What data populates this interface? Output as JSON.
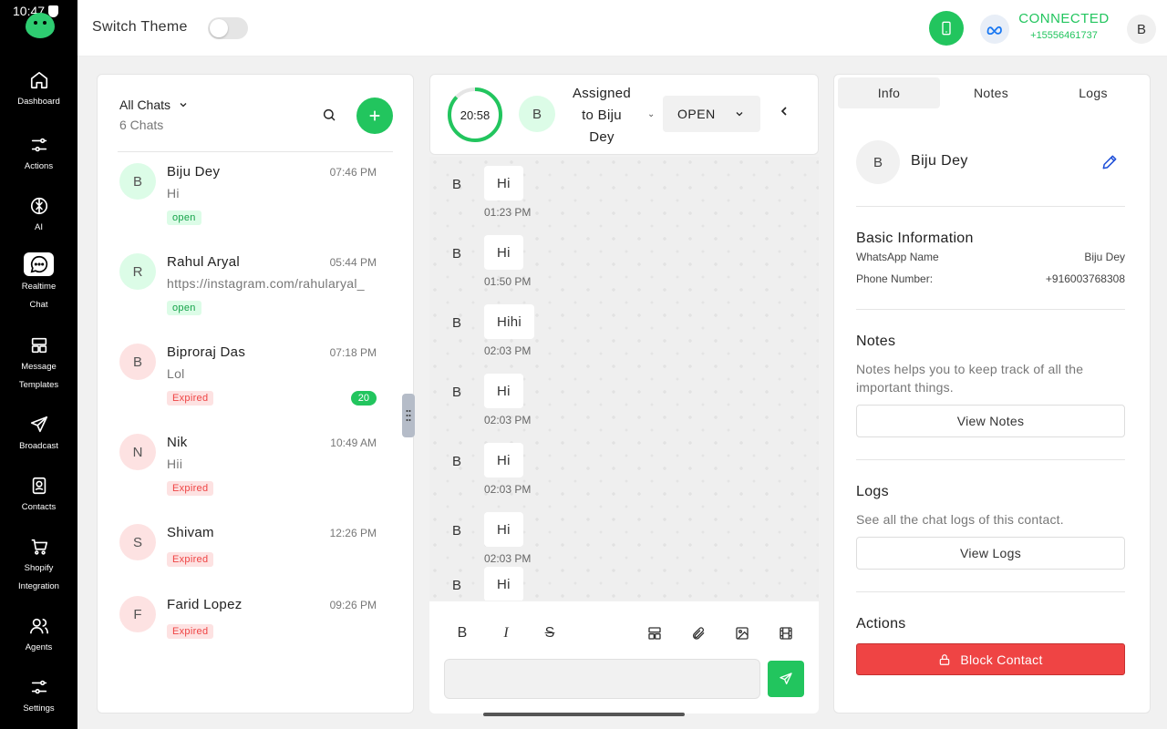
{
  "status_bar": {
    "time": "10:47"
  },
  "sidebar": {
    "items": [
      {
        "label": "Dashboard",
        "icon": "home-icon"
      },
      {
        "label": "Actions",
        "icon": "sliders-icon"
      },
      {
        "label": "AI",
        "icon": "brain-icon"
      },
      {
        "label_line1": "Realtime",
        "label_line2": "Chat",
        "icon": "chat-bubble-icon",
        "active": true
      },
      {
        "label_line1": "Message",
        "label_line2": "Templates",
        "icon": "template-icon"
      },
      {
        "label": "Broadcast",
        "icon": "send-icon"
      },
      {
        "label": "Contacts",
        "icon": "contact-card-icon"
      },
      {
        "label_line1": "Shopify",
        "label_line2": "Integration",
        "icon": "cart-icon"
      },
      {
        "label": "Agents",
        "icon": "users-icon"
      },
      {
        "label": "Settings",
        "icon": "settings-sliders-icon"
      }
    ]
  },
  "topbar": {
    "theme_label": "Switch Theme",
    "theme_dark": false,
    "connection_status": "CONNECTED",
    "phone_number": "+15556461737",
    "user_initial": "B",
    "accent_color": "#22c55e"
  },
  "chat_list": {
    "filter_label": "All Chats",
    "count_label": "6 Chats",
    "chats": [
      {
        "initial": "B",
        "name": "Biju Dey",
        "time": "07:46 PM",
        "preview": "Hi",
        "status": "open"
      },
      {
        "initial": "R",
        "name": "Rahul Aryal",
        "time": "05:44 PM",
        "preview": "https://instagram.com/rahularyal_",
        "status": "open"
      },
      {
        "initial": "B",
        "name": "Biproraj Das",
        "time": "07:18 PM",
        "preview": "Lol",
        "status": "Expired",
        "unread": "20"
      },
      {
        "initial": "N",
        "name": "Nik",
        "time": "10:49 AM",
        "preview": "Hii",
        "status": "Expired"
      },
      {
        "initial": "S",
        "name": "Shivam",
        "time": "12:26 PM",
        "preview": "",
        "status": "Expired"
      },
      {
        "initial": "F",
        "name": "Farid Lopez",
        "time": "09:26 PM",
        "preview": "",
        "status": "Expired"
      }
    ]
  },
  "chat_header": {
    "timer": "20:58",
    "timer_fraction_remaining": 0.87,
    "assignee_initial": "B",
    "assigned_line1": "Assigned",
    "assigned_line2": "to Biju",
    "assigned_line3": "Dey",
    "status_value": "OPEN"
  },
  "messages": [
    {
      "initial": "B",
      "text": "Hi",
      "time": "01:23 PM"
    },
    {
      "initial": "B",
      "text": "Hi",
      "time": "01:50 PM"
    },
    {
      "initial": "B",
      "text": "Hihi",
      "time": "02:03 PM"
    },
    {
      "initial": "B",
      "text": "Hi",
      "time": "02:03 PM"
    },
    {
      "initial": "B",
      "text": "Hi",
      "time": "02:03 PM"
    },
    {
      "initial": "B",
      "text": "Hi",
      "time": "02:03 PM"
    },
    {
      "initial": "B",
      "text": "Hi",
      "time": ""
    }
  ],
  "composer": {
    "bold": "B",
    "italic": "I",
    "strike": "S",
    "input_value": ""
  },
  "info_panel": {
    "tabs": [
      "Info",
      "Notes",
      "Logs"
    ],
    "active_tab": "Info",
    "contact_initial": "B",
    "contact_name": "Biju Dey",
    "basic_title": "Basic Information",
    "whatsapp_name_label": "WhatsApp Name",
    "whatsapp_name_value": "Biju Dey",
    "phone_label": "Phone Number:",
    "phone_value": "+916003768308",
    "notes_title": "Notes",
    "notes_desc": "Notes helps you to keep track of all the important things.",
    "view_notes": "View Notes",
    "logs_title": "Logs",
    "logs_desc": "See all the chat logs of this contact.",
    "view_logs": "View Logs",
    "actions_title": "Actions",
    "block_label": "Block Contact",
    "danger_color": "#ef4444"
  }
}
